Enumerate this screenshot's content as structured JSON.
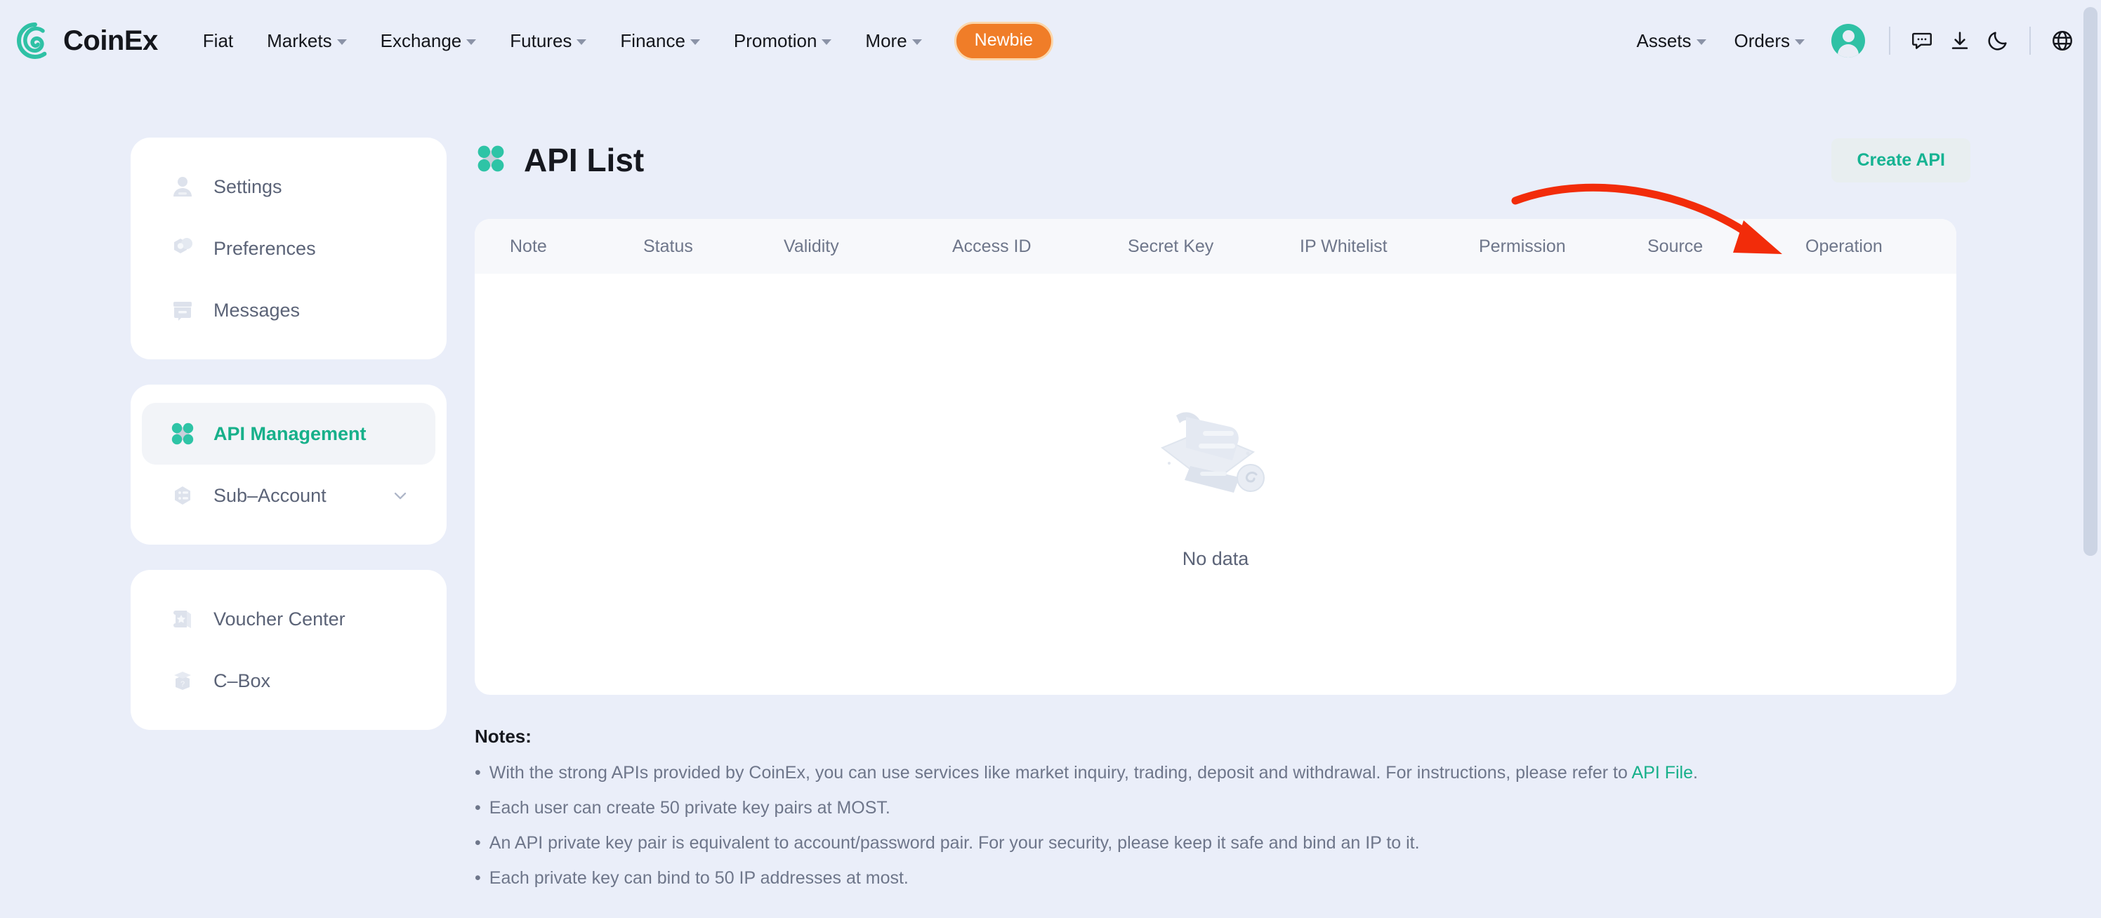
{
  "brand": {
    "name": "CoinEx",
    "accent": "#17b08a",
    "logo_icon": "coinex-spiral-logo"
  },
  "header": {
    "nav": [
      {
        "label": "Fiat",
        "has_caret": false
      },
      {
        "label": "Markets",
        "has_caret": true
      },
      {
        "label": "Exchange",
        "has_caret": true
      },
      {
        "label": "Futures",
        "has_caret": true
      },
      {
        "label": "Finance",
        "has_caret": true
      },
      {
        "label": "Promotion",
        "has_caret": true
      },
      {
        "label": "More",
        "has_caret": true
      }
    ],
    "newbie_label": "Newbie",
    "newbie_color": "#f07d28",
    "right": [
      {
        "label": "Assets",
        "has_caret": true
      },
      {
        "label": "Orders",
        "has_caret": true
      }
    ],
    "icons": {
      "avatar": "user-avatar",
      "chat": "chat-bubble-icon",
      "download": "download-icon",
      "theme": "moon-icon",
      "language": "globe-icon"
    }
  },
  "sidebar": {
    "groups": [
      {
        "items": [
          {
            "label": "Settings",
            "icon": "user-settings-icon",
            "active": false,
            "chevron": false
          },
          {
            "label": "Preferences",
            "icon": "preferences-gear-icon",
            "active": false,
            "chevron": false
          },
          {
            "label": "Messages",
            "icon": "messages-inbox-icon",
            "active": false,
            "chevron": false
          }
        ]
      },
      {
        "items": [
          {
            "label": "API Management",
            "icon": "api-grid-icon",
            "active": true,
            "chevron": false
          },
          {
            "label": "Sub–Account",
            "icon": "sub-account-icon",
            "active": false,
            "chevron": true
          }
        ]
      },
      {
        "items": [
          {
            "label": "Voucher Center",
            "icon": "voucher-ticket-icon",
            "active": false,
            "chevron": false
          },
          {
            "label": "C–Box",
            "icon": "cbox-icon",
            "active": false,
            "chevron": false
          }
        ]
      }
    ]
  },
  "main": {
    "title": "API List",
    "title_icon": "api-grid-icon",
    "create_button": "Create API",
    "table": {
      "columns": [
        "Note",
        "Status",
        "Validity",
        "Access ID",
        "Secret Key",
        "IP Whitelist",
        "Permission",
        "Source",
        "Operation"
      ],
      "rows": [],
      "empty_text": "No data",
      "empty_illustration": "empty-scroll-illustration"
    },
    "notes": {
      "title": "Notes:",
      "items": [
        {
          "text_before": "With the strong APIs provided by CoinEx, you can use services like market inquiry, trading, deposit and withdrawal. For instructions, please refer to ",
          "link": "API File",
          "text_after": "."
        },
        {
          "text_before": "Each user can create 50 private key pairs at MOST.",
          "link": "",
          "text_after": ""
        },
        {
          "text_before": "An API private key pair is equivalent to account/password pair. For your security, please keep it safe and bind an IP to it.",
          "link": "",
          "text_after": ""
        },
        {
          "text_before": "Each private key can bind to 50 IP addresses at most.",
          "link": "",
          "text_after": ""
        }
      ],
      "bullet": "•"
    }
  },
  "annotation": {
    "type": "curved-arrow",
    "color": "#f22c0a",
    "points_to": "Create API"
  }
}
